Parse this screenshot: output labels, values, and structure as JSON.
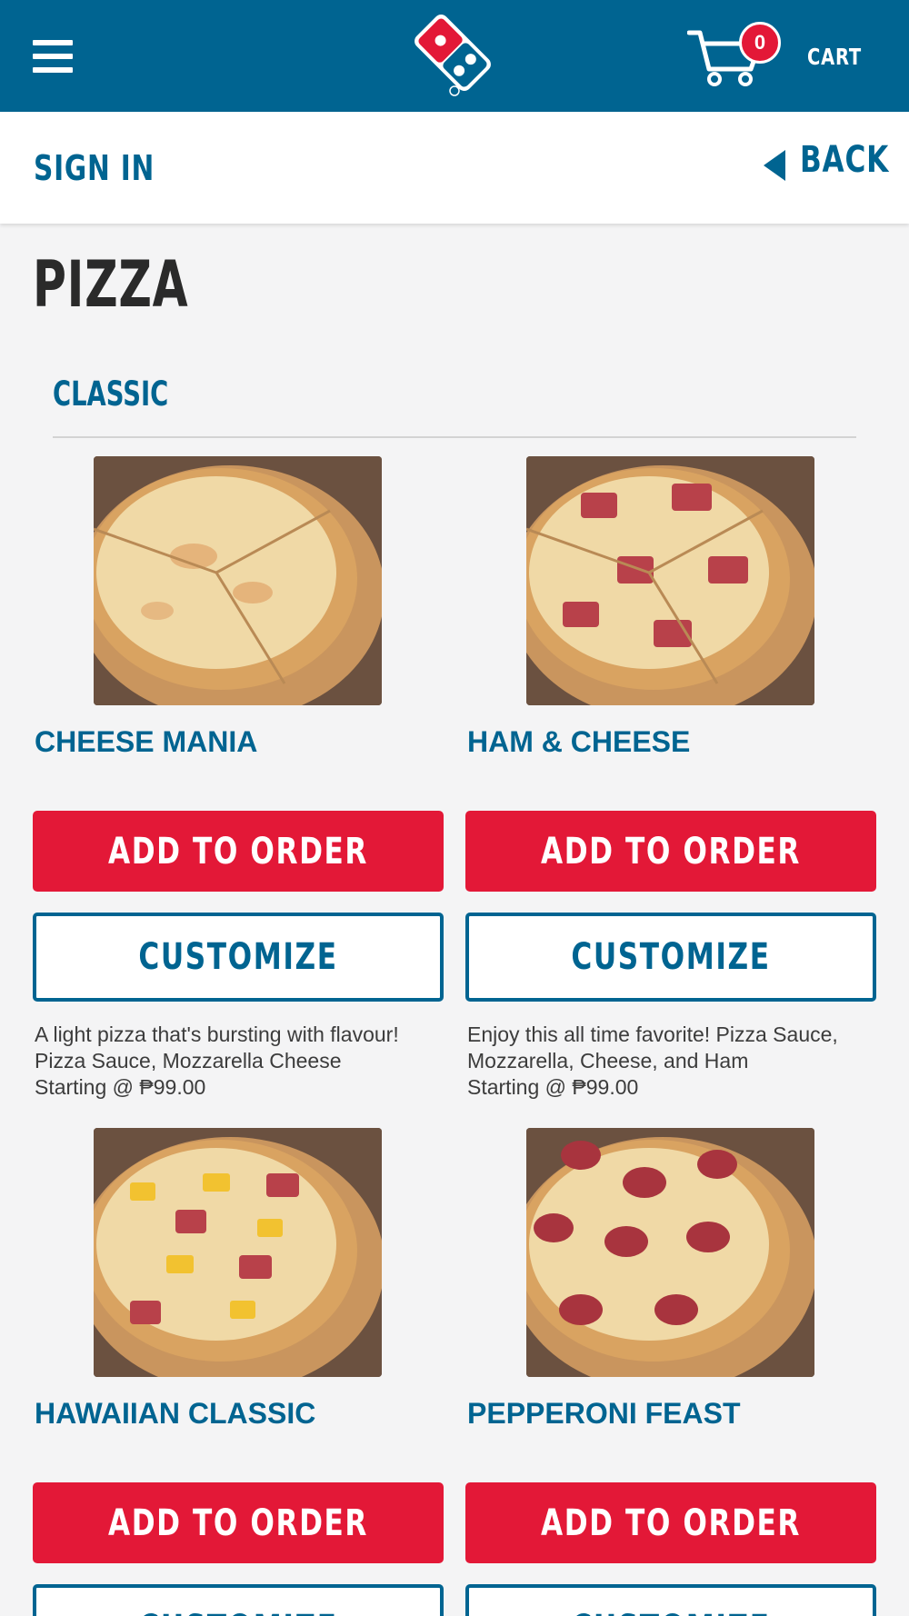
{
  "header": {
    "cart_count": "0",
    "cart_label": "CART",
    "colors": {
      "brand_blue": "#006491",
      "brand_red": "#e31837"
    }
  },
  "subheader": {
    "sign_in": "SIGN IN",
    "back": "BACK"
  },
  "page": {
    "title": "PIZZA",
    "section": "CLASSIC"
  },
  "products": [
    {
      "name": "CHEESE MANIA",
      "add_label": "ADD TO ORDER",
      "customize_label": "CUSTOMIZE",
      "description": "A light pizza that's bursting with flavour!",
      "ingredients": "Pizza Sauce, Mozzarella Cheese",
      "price": "Starting @ ₱99.00"
    },
    {
      "name": "HAM & CHEESE",
      "add_label": "ADD TO ORDER",
      "customize_label": "CUSTOMIZE",
      "description": "Enjoy this all time favorite! Pizza Sauce,",
      "ingredients": "Mozzarella, Cheese, and Ham",
      "price": "Starting @ ₱99.00"
    },
    {
      "name": "HAWAIIAN CLASSIC",
      "add_label": "ADD TO ORDER",
      "customize_label": "CUSTOMIZE"
    },
    {
      "name": "PEPPERONI FEAST",
      "add_label": "ADD TO ORDER",
      "customize_label": "CUSTOMIZE"
    }
  ]
}
